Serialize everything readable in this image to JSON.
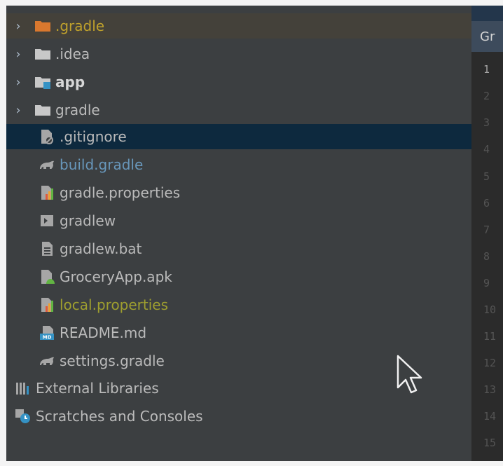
{
  "project_tree": {
    "items": [
      {
        "label": ".gradle",
        "type": "folder",
        "expandable": true,
        "style": "ignored",
        "icon": "folder-icon-orange"
      },
      {
        "label": ".idea",
        "type": "folder",
        "expandable": true,
        "style": "normal",
        "icon": "folder-icon"
      },
      {
        "label": "app",
        "type": "module",
        "expandable": true,
        "style": "bold",
        "icon": "module-folder-icon"
      },
      {
        "label": "gradle",
        "type": "folder",
        "expandable": true,
        "style": "normal",
        "icon": "folder-icon"
      },
      {
        "label": ".gitignore",
        "type": "file",
        "expandable": false,
        "style": "normal",
        "icon": "gitignore-file-icon",
        "selected": true
      },
      {
        "label": "build.gradle",
        "type": "file",
        "expandable": false,
        "style": "modified",
        "icon": "gradle-elephant-icon"
      },
      {
        "label": "gradle.properties",
        "type": "file",
        "expandable": false,
        "style": "normal",
        "icon": "properties-file-icon"
      },
      {
        "label": "gradlew",
        "type": "file",
        "expandable": false,
        "style": "normal",
        "icon": "terminal-file-icon"
      },
      {
        "label": "gradlew.bat",
        "type": "file",
        "expandable": false,
        "style": "normal",
        "icon": "text-file-icon"
      },
      {
        "label": "GroceryApp.apk",
        "type": "file",
        "expandable": false,
        "style": "normal",
        "icon": "apk-file-icon"
      },
      {
        "label": "local.properties",
        "type": "file",
        "expandable": false,
        "style": "unversioned",
        "icon": "properties-file-icon"
      },
      {
        "label": "README.md",
        "type": "file",
        "expandable": false,
        "style": "normal",
        "icon": "markdown-file-icon"
      },
      {
        "label": "settings.gradle",
        "type": "file",
        "expandable": false,
        "style": "normal",
        "icon": "gradle-elephant-icon"
      },
      {
        "label": "External Libraries",
        "type": "node",
        "expandable": false,
        "style": "normal",
        "icon": "libraries-icon"
      },
      {
        "label": "Scratches and Consoles",
        "type": "node",
        "expandable": false,
        "style": "normal",
        "icon": "scratches-icon"
      }
    ]
  },
  "editor": {
    "tab_label": "Gr",
    "line_numbers": [
      "1",
      "2",
      "3",
      "4",
      "5",
      "6",
      "7",
      "8",
      "9",
      "10",
      "11",
      "12",
      "13",
      "14",
      "15"
    ],
    "active_line": "1"
  },
  "colors": {
    "tree_bg": "#3c3f41",
    "selection": "#0d293e",
    "ignored_text": "#bfa12c",
    "modified_text": "#6897bb",
    "unversioned_text": "#9f9f2f"
  }
}
